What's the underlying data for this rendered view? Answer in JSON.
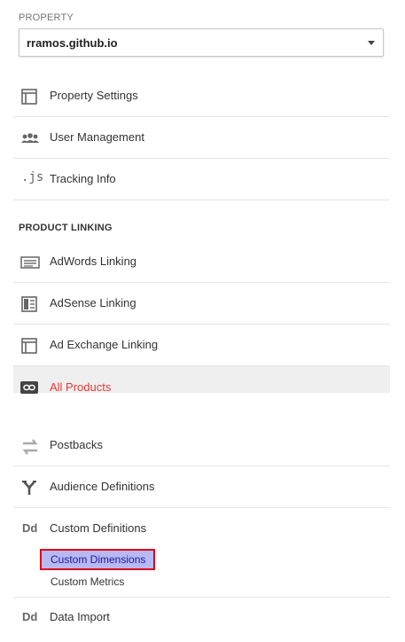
{
  "property": {
    "label": "PROPERTY",
    "selected": "rramos.github.io"
  },
  "nav": {
    "property_settings": "Property Settings",
    "user_management": "User Management",
    "tracking_info": "Tracking Info",
    "js_icon_text": ".js"
  },
  "product_linking": {
    "label": "PRODUCT LINKING",
    "adwords": "AdWords Linking",
    "adsense": "AdSense Linking",
    "ad_exchange": "Ad Exchange Linking",
    "all_products": "All Products"
  },
  "more": {
    "postbacks": "Postbacks",
    "audience_definitions": "Audience Definitions",
    "custom_definitions": "Custom Definitions",
    "custom_definitions_icon_text": "Dd",
    "custom_dimensions": "Custom Dimensions",
    "custom_metrics": "Custom Metrics",
    "data_import": "Data Import",
    "data_import_icon_text": "Dd"
  },
  "colors": {
    "active_text": "#e53935",
    "highlight_bg": "#b8b8f3",
    "highlight_border": "#e0001b"
  }
}
